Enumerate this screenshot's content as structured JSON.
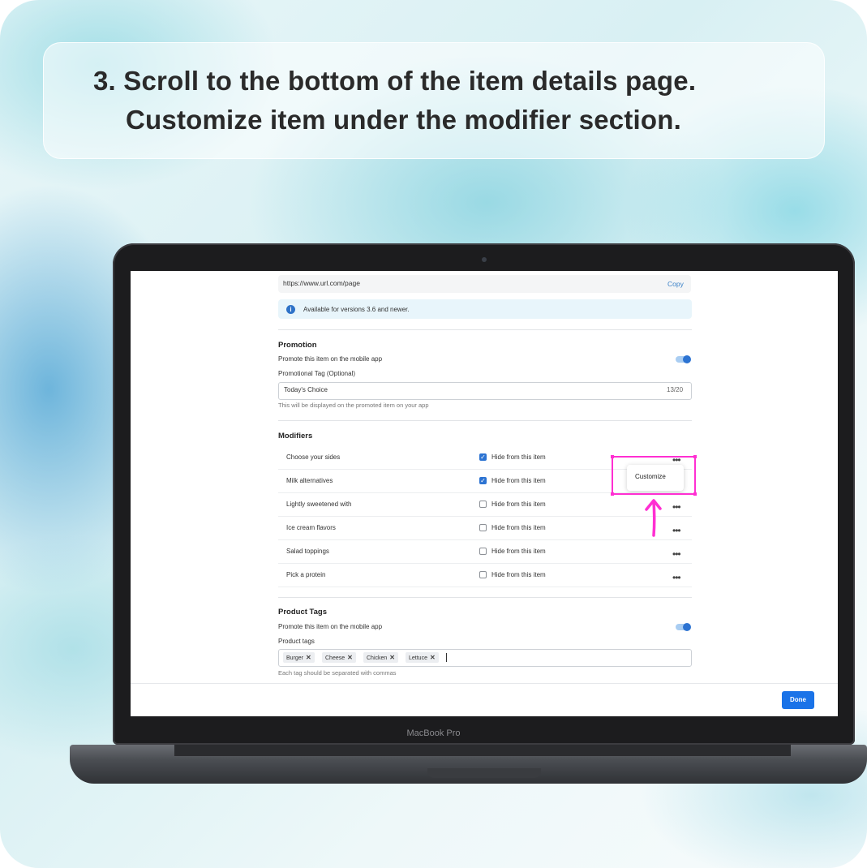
{
  "instruction": {
    "line1": "3. Scroll to the bottom of the item details page.",
    "line2": "Customize item under the modifier section."
  },
  "device": {
    "brand": "MacBook Pro"
  },
  "colors": {
    "accent": "#1a73e8",
    "highlight": "#ff2fd2",
    "checkbox_on": "#2c73d2"
  },
  "link_section": {
    "url": "https://www.url.com/page",
    "copy_label": "Copy",
    "info_icon": "info-icon",
    "info_text": "Available for versions 3.6 and newer."
  },
  "promotion": {
    "title": "Promotion",
    "toggle_label": "Promote this item on the mobile app",
    "toggle_on": true,
    "tag_label": "Promotional Tag (Optional)",
    "tag_value": "Today's Choice",
    "tag_counter": "13/20",
    "tag_hint": "This will be displayed on the promoted item on your app"
  },
  "modifiers": {
    "title": "Modifiers",
    "checkbox_label": "Hide from this item",
    "more_icon": "more-horizontal-icon",
    "rows": [
      {
        "name": "Choose your sides",
        "hidden": true
      },
      {
        "name": "Milk alternatives",
        "hidden": true
      },
      {
        "name": "Lightly sweetened with",
        "hidden": false
      },
      {
        "name": "Ice cream flavors",
        "hidden": false
      },
      {
        "name": "Salad toppings",
        "hidden": false
      },
      {
        "name": "Pick a protein",
        "hidden": false
      }
    ],
    "popover_item": "Customize"
  },
  "product_tags": {
    "title": "Product Tags",
    "toggle_label": "Promote this item on the mobile app",
    "toggle_on": true,
    "field_label": "Product tags",
    "tags": [
      "Burger",
      "Cheese",
      "Chicken",
      "Lettuce"
    ],
    "hint": "Each tag should be separated with commas"
  },
  "footer": {
    "done_label": "Done"
  }
}
